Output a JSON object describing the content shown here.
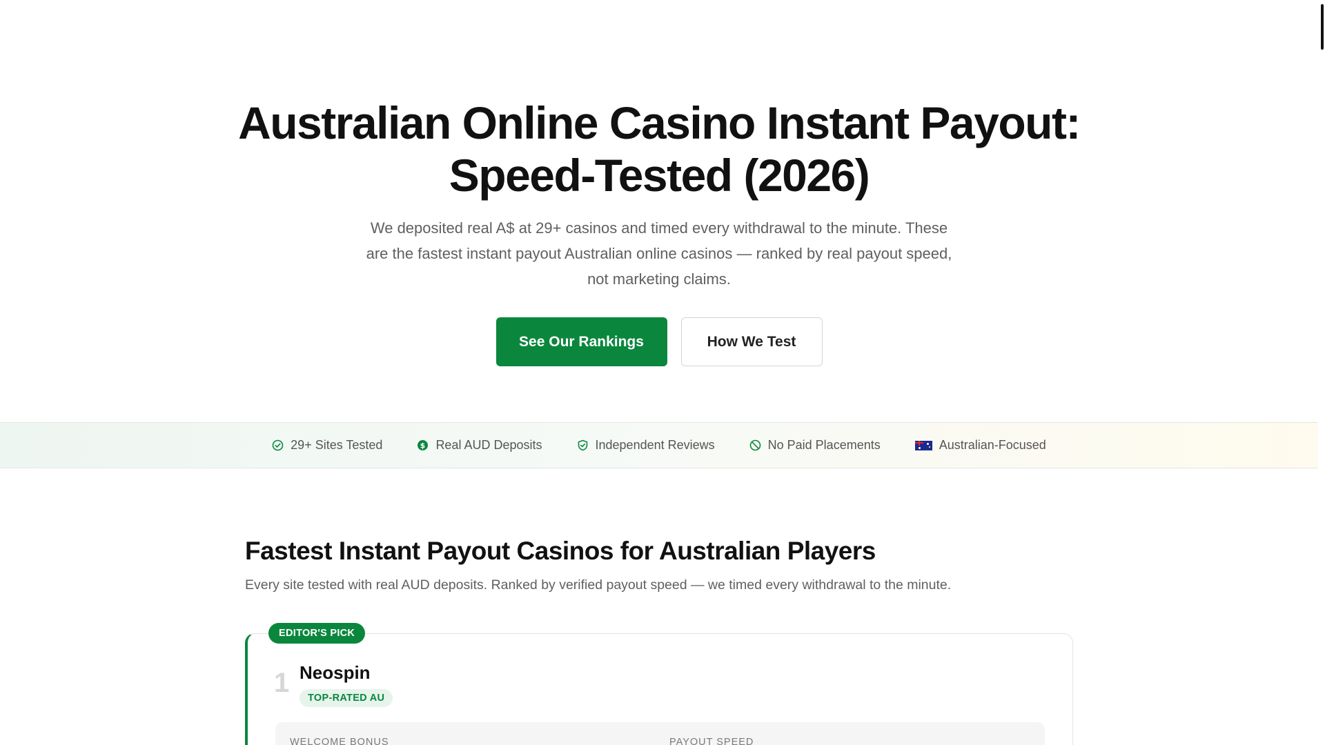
{
  "hero": {
    "title": "Australian Online Casino Instant Payout: Speed-Tested (2026)",
    "subtitle": "We deposited real A$ at 29+ casinos and timed every withdrawal to the minute. These are the fastest instant payout Australian online casinos — ranked by real payout speed, not marketing claims.",
    "primary_button": "See Our Rankings",
    "secondary_button": "How We Test"
  },
  "trust_bar": {
    "items": [
      {
        "label": "29+ Sites Tested",
        "icon": "check-circle-icon"
      },
      {
        "label": "Real AUD Deposits",
        "icon": "dollar-circle-icon"
      },
      {
        "label": "Independent Reviews",
        "icon": "shield-check-icon"
      },
      {
        "label": "No Paid Placements",
        "icon": "ban-icon"
      },
      {
        "label": "Australian-Focused",
        "icon": "australia-flag-icon"
      }
    ]
  },
  "rankings": {
    "title": "Fastest Instant Payout Casinos for Australian Players",
    "subtitle": "Every site tested with real AUD deposits. Ranked by verified payout speed — we timed every withdrawal to the minute.",
    "top_card": {
      "badge": "EDITOR'S PICK",
      "rank": "1",
      "name": "Neospin",
      "tag": "TOP-RATED AU",
      "stat_labels": [
        "WELCOME BONUS",
        "PAYOUT SPEED"
      ]
    }
  },
  "colors": {
    "accent": "#0a873d",
    "text": "#111111",
    "muted": "#5f5f5f"
  }
}
